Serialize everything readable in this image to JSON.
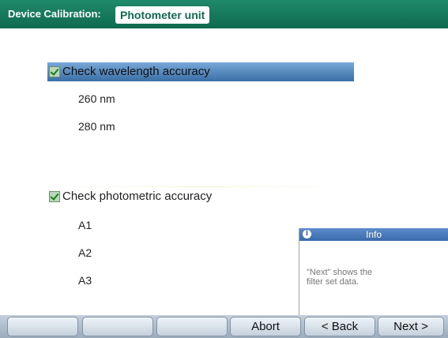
{
  "header": {
    "title": "Device Calibration:",
    "tab_label": "Photometer unit"
  },
  "checklist": [
    {
      "label": "Check wavelength accuracy",
      "checked": true,
      "selected": true,
      "subitems": [
        "260 nm",
        "280 nm"
      ]
    },
    {
      "label": "Check photometric accuracy",
      "checked": true,
      "selected": false,
      "subitems": [
        "A1",
        "A2",
        "A3"
      ]
    }
  ],
  "info": {
    "title": "Info",
    "message": "\"Next\" shows the\nfilter set data."
  },
  "buttons": [
    "",
    "",
    "",
    "Abort",
    "< Back",
    "Next >"
  ],
  "colors": {
    "header": "#0f6a4f",
    "selection": "#3a6ea5",
    "check": "#1b7b1b"
  }
}
